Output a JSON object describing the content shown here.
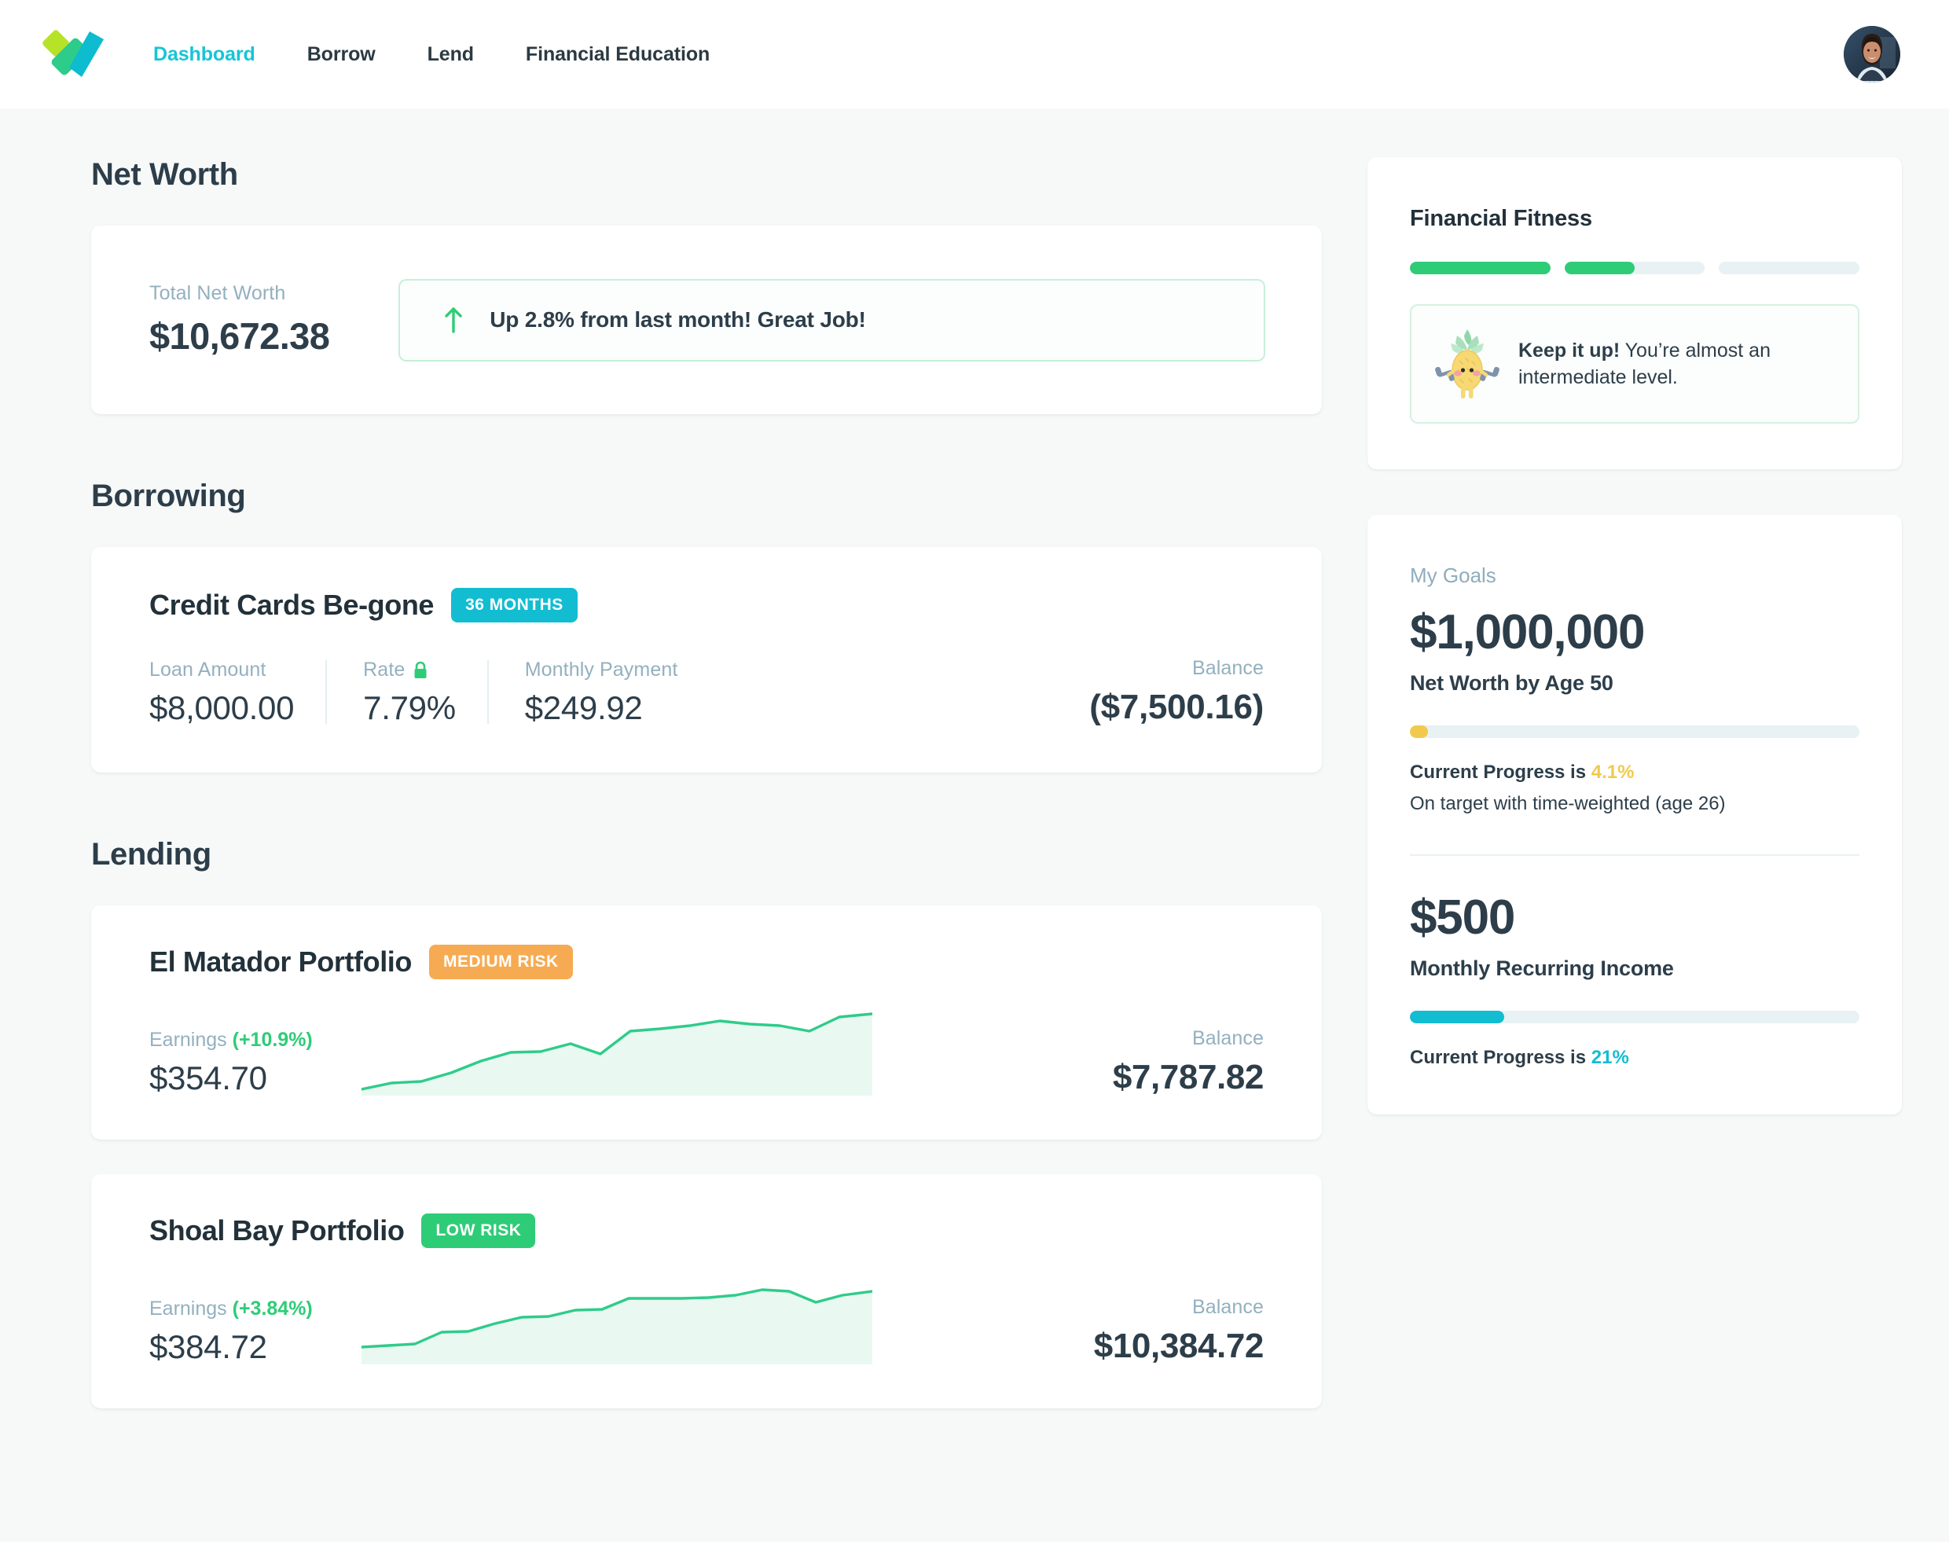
{
  "nav": {
    "logo_name": "velocity-logo",
    "links": [
      {
        "label": "Dashboard",
        "active": true
      },
      {
        "label": "Borrow",
        "active": false
      },
      {
        "label": "Lend",
        "active": false
      },
      {
        "label": "Financial Education",
        "active": false
      }
    ],
    "avatar_alt": "User profile photo"
  },
  "net_worth": {
    "section_title": "Net Worth",
    "total_label": "Total Net Worth",
    "total_value": "$10,672.38",
    "banner_text": "Up 2.8% from last month!  Great Job!",
    "banner_direction": "up",
    "banner_border_color": "#c8efda",
    "arrow_color": "#2ecc77"
  },
  "borrowing": {
    "section_title": "Borrowing",
    "loan": {
      "title": "Credit Cards Be-gone",
      "term_badge": "36 MONTHS",
      "term_badge_color": "#12bdd2",
      "loan_amount_label": "Loan Amount",
      "loan_amount_value": "$8,000.00",
      "rate_label": "Rate",
      "rate_locked": true,
      "rate_value": "7.79%",
      "monthly_payment_label": "Monthly Payment",
      "monthly_payment_value": "$249.92",
      "balance_label": "Balance",
      "balance_value": "($7,500.16)"
    }
  },
  "lending": {
    "section_title": "Lending",
    "portfolios": [
      {
        "title": "El Matador Portfolio",
        "risk_badge": "MEDIUM RISK",
        "risk_color": "#f6ab52",
        "earnings_label": "Earnings",
        "earnings_pct": "(+10.9%)",
        "earnings_value": "$354.70",
        "balance_label": "Balance",
        "balance_value": "$7,787.82"
      },
      {
        "title": "Shoal Bay Portfolio",
        "risk_badge": "LOW RISK",
        "risk_color": "#2ecc77",
        "earnings_label": "Earnings",
        "earnings_pct": "(+3.84%)",
        "earnings_value": "$384.72",
        "balance_label": "Balance",
        "balance_value": "$10,384.72"
      }
    ]
  },
  "fitness": {
    "title": "Financial Fitness",
    "segments": [
      100,
      50,
      0
    ],
    "fill_color": "#2ecc77",
    "track_color": "#e8f1f3",
    "tip_bold": "Keep it up!",
    "tip_rest": " You’re almost an intermediate level.",
    "mascot": "pineapple-lifting-weights-icon"
  },
  "goals": {
    "label": "My Goals",
    "items": [
      {
        "amount": "$1,000,000",
        "subtitle": "Net Worth by Age 50",
        "progress_pct": 4.1,
        "bar_color": "#f2c94c",
        "progress_prefix": "Current Progress is ",
        "progress_value": "4.1%",
        "note": "On target with time-weighted (age 26)"
      },
      {
        "amount": "$500",
        "subtitle": "Monthly Recurring Income",
        "progress_pct": 21,
        "bar_color": "#12bdd2",
        "progress_prefix": "Current Progress is ",
        "progress_value": "21%",
        "note": ""
      }
    ]
  },
  "chart_data": [
    {
      "type": "area",
      "title": "El Matador Portfolio earnings sparkline",
      "series": [
        {
          "name": "El Matador",
          "values": [
            4,
            8,
            9,
            16,
            26,
            33,
            34,
            41,
            32,
            52,
            54,
            57,
            61,
            58,
            57,
            52,
            64,
            68
          ]
        }
      ],
      "x": [
        0,
        1,
        2,
        3,
        4,
        5,
        6,
        7,
        8,
        9,
        10,
        11,
        12,
        13,
        14,
        15,
        16,
        17
      ],
      "line_color": "#2ecc8a",
      "fill_color": "#e9f9f1",
      "grid": false,
      "ylim": [
        0,
        72
      ]
    },
    {
      "type": "area",
      "title": "Shoal Bay Portfolio earnings sparkline",
      "series": [
        {
          "name": "Shoal Bay",
          "values": [
            10,
            11,
            12,
            22,
            23,
            30,
            36,
            37,
            43,
            44,
            55,
            55,
            55,
            56,
            58,
            63,
            62,
            52,
            58,
            62
          ]
        }
      ],
      "x": [
        0,
        1,
        2,
        3,
        4,
        5,
        6,
        7,
        8,
        9,
        10,
        11,
        12,
        13,
        14,
        15,
        16,
        17,
        18,
        19
      ],
      "line_color": "#2ecc8a",
      "fill_color": "#e9f9f1",
      "grid": false,
      "ylim": [
        0,
        72
      ]
    }
  ]
}
